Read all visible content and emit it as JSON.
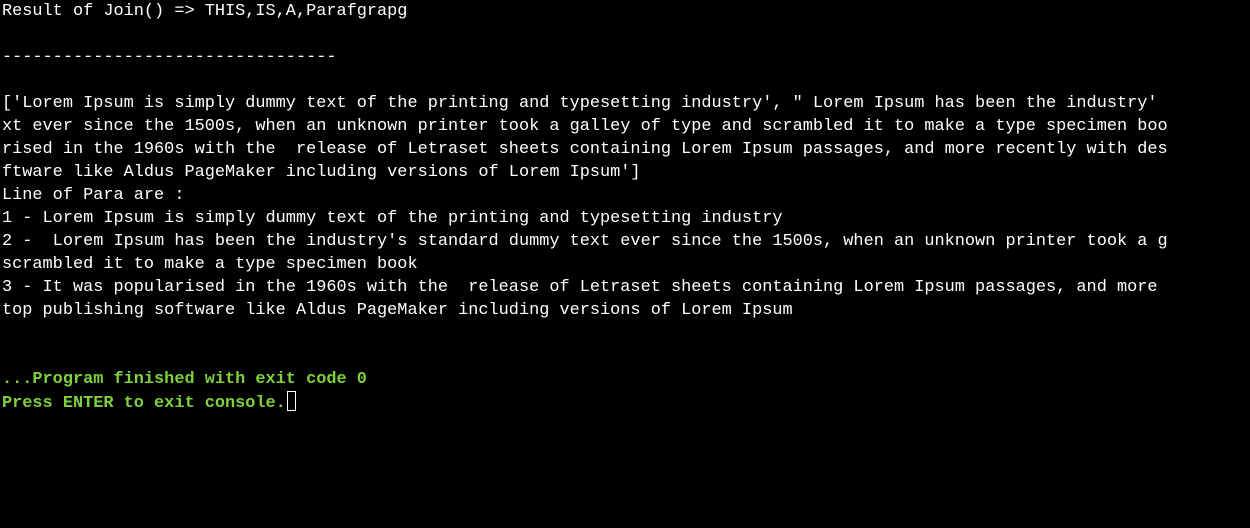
{
  "console": {
    "join_result": "Result of Join() => THIS,IS,A,Parafgrapg",
    "separator": "---------------------------------",
    "list_lines": [
      "['Lorem Ipsum is simply dummy text of the printing and typesetting industry', \" Lorem Ipsum has been the industry'",
      "xt ever since the 1500s, when an unknown printer took a galley of type and scrambled it to make a type specimen boo",
      "rised in the 1960s with the  release of Letraset sheets containing Lorem Ipsum passages, and more recently with des",
      "ftware like Aldus PageMaker including versions of Lorem Ipsum']"
    ],
    "para_heading": "Line of Para are :",
    "para_lines": [
      "1 - Lorem Ipsum is simply dummy text of the printing and typesetting industry",
      "2 -  Lorem Ipsum has been the industry's standard dummy text ever since the 1500s, when an unknown printer took a g",
      "scrambled it to make a type specimen book",
      "3 - It was popularised in the 1960s with the  release of Letraset sheets containing Lorem Ipsum passages, and more",
      "top publishing software like Aldus PageMaker including versions of Lorem Ipsum"
    ],
    "finished_message": "...Program finished with exit code 0",
    "exit_prompt": "Press ENTER to exit console."
  },
  "colors": {
    "background": "#000000",
    "text": "#ffffff",
    "status_green": "#7ed13c"
  }
}
